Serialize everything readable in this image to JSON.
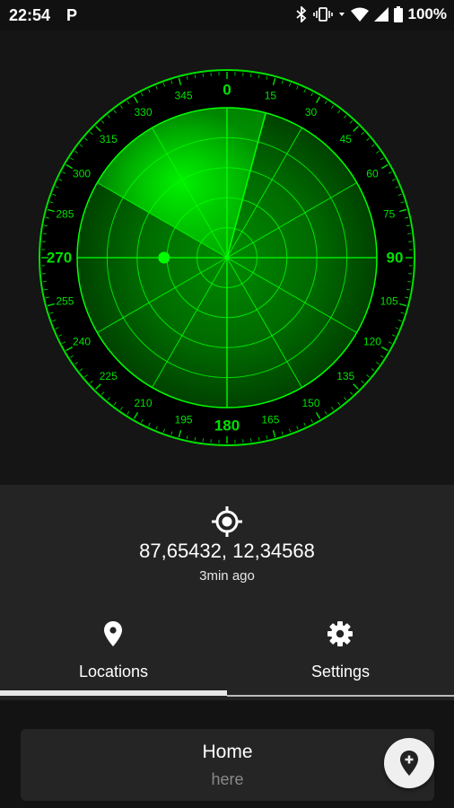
{
  "status_bar": {
    "time": "22:54",
    "app_icon": "P",
    "battery": "100%",
    "icons": [
      "bluetooth-icon",
      "vibrate-icon",
      "wifi-icon",
      "signal-icon",
      "battery-icon"
    ]
  },
  "radar": {
    "major_labels": [
      "0",
      "90",
      "180",
      "270"
    ],
    "minor_labels": [
      "15",
      "30",
      "45",
      "60",
      "75",
      "105",
      "120",
      "135",
      "150",
      "165",
      "195",
      "210",
      "225",
      "240",
      "255",
      "285",
      "300",
      "315",
      "330",
      "345"
    ],
    "colors": {
      "ring": "#00e000",
      "grid": "#00ff00",
      "disc_dark": "#004a00",
      "disc_light": "#00b000",
      "sweep": "#00ff00"
    },
    "sweep_start_deg": 300,
    "sweep_end_deg": 15,
    "target_bearing_deg": 270,
    "target_distance_fraction": 0.42
  },
  "location": {
    "coordinates": "87,65432, 12,34568",
    "updated": "3min ago"
  },
  "tabs": {
    "locations": "Locations",
    "settings": "Settings",
    "selected": "Locations"
  },
  "list": {
    "items": [
      {
        "title": "Home",
        "subtitle": "here"
      }
    ]
  },
  "fab": {
    "icon": "add-location-icon"
  }
}
